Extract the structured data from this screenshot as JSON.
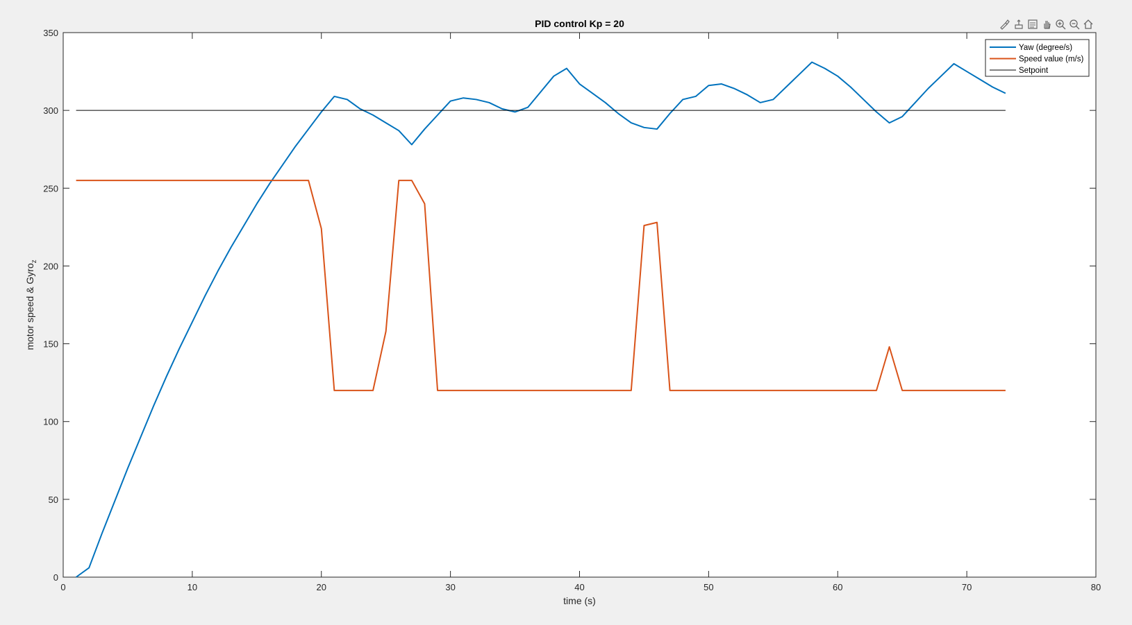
{
  "toolbar": {
    "icons": [
      "brush-icon",
      "data-tips-icon",
      "legend-icon",
      "pan-icon",
      "zoom-in-icon",
      "zoom-out-icon",
      "home-icon"
    ]
  },
  "chart_data": {
    "type": "line",
    "title": "PID control Kp = 20",
    "xlabel": "time (s)",
    "ylabel_main": "motor speed & Gyro",
    "ylabel_sub": "z",
    "xlim": [
      0,
      80
    ],
    "ylim": [
      0,
      350
    ],
    "xticks": [
      0,
      10,
      20,
      30,
      40,
      50,
      60,
      70,
      80
    ],
    "yticks": [
      0,
      50,
      100,
      150,
      200,
      250,
      300,
      350
    ],
    "grid": false,
    "legend_position": "top-right",
    "series": [
      {
        "name": "Yaw (degree/s)",
        "color": "#0072BD",
        "x": [
          1,
          2,
          3,
          4,
          5,
          6,
          7,
          8,
          9,
          10,
          11,
          12,
          13,
          14,
          15,
          16,
          17,
          18,
          19,
          20,
          21,
          22,
          23,
          24,
          25,
          26,
          27,
          28,
          29,
          30,
          31,
          32,
          33,
          34,
          35,
          36,
          37,
          38,
          39,
          40,
          41,
          42,
          43,
          44,
          45,
          46,
          47,
          48,
          49,
          50,
          51,
          52,
          53,
          54,
          55,
          56,
          57,
          58,
          59,
          60,
          61,
          62,
          63,
          64,
          65,
          66,
          67,
          68,
          69,
          70,
          71,
          72,
          73
        ],
        "y": [
          0,
          6,
          28,
          49,
          70,
          90,
          110,
          129,
          147,
          164,
          181,
          197,
          212,
          226,
          240,
          253,
          265,
          277,
          288,
          299,
          309,
          307,
          301,
          297,
          292,
          287,
          278,
          288,
          297,
          306,
          308,
          307,
          305,
          301,
          299,
          302,
          312,
          322,
          327,
          317,
          311,
          305,
          298,
          292,
          289,
          288,
          298,
          307,
          309,
          316,
          317,
          314,
          310,
          305,
          307,
          315,
          323,
          331,
          327,
          322,
          315,
          307,
          299,
          292,
          296,
          305,
          314,
          322,
          330,
          325,
          320,
          315,
          311
        ]
      },
      {
        "name": "Speed value (m/s)",
        "color": "#D95319",
        "x": [
          1,
          19,
          20,
          21,
          24,
          25,
          26,
          27,
          28,
          29,
          44,
          45,
          46,
          47,
          63,
          64,
          65,
          73
        ],
        "y": [
          255,
          255,
          224,
          120,
          120,
          158,
          255,
          255,
          240,
          120,
          120,
          226,
          228,
          120,
          120,
          148,
          120,
          120
        ]
      },
      {
        "name": "Setpoint",
        "color": "#000000",
        "x": [
          1,
          73
        ],
        "y": [
          300,
          300
        ]
      }
    ]
  }
}
